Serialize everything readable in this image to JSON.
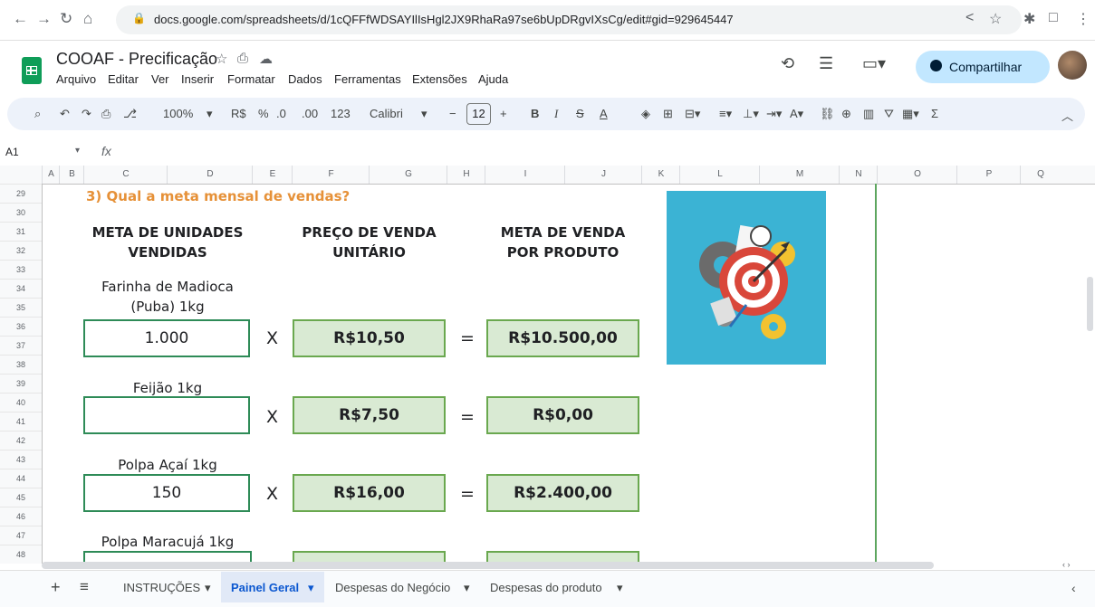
{
  "browser": {
    "url": "docs.google.com/spreadsheets/d/1cQFFfWDSAYIlIsHgl2JX9RhaRa97se6bUpDRgvIXsCg/edit#gid=929645447"
  },
  "doc": {
    "title": "COOAF - Precificação",
    "share_label": "Compartilhar",
    "menu": [
      "Arquivo",
      "Editar",
      "Ver",
      "Inserir",
      "Formatar",
      "Dados",
      "Ferramentas",
      "Extensões",
      "Ajuda"
    ]
  },
  "toolbar": {
    "zoom": "100%",
    "currency": "R$",
    "percent": "%",
    "dec_less": ".0",
    "dec_more": ".00",
    "number_format": "123",
    "font": "Calibri",
    "font_size": "12",
    "bold": "B",
    "italic": "I",
    "text_color": "A"
  },
  "formula": {
    "cell_ref": "A1",
    "fx": "fx"
  },
  "columns": [
    "A",
    "B",
    "C",
    "D",
    "E",
    "F",
    "G",
    "H",
    "I",
    "J",
    "K",
    "L",
    "M",
    "N",
    "O",
    "P",
    "Q"
  ],
  "rows": [
    "29",
    "30",
    "31",
    "32",
    "33",
    "34",
    "35",
    "36",
    "37",
    "38",
    "39",
    "40",
    "41",
    "42",
    "43",
    "44",
    "45",
    "46",
    "47",
    "48"
  ],
  "sheet": {
    "heading": "3) Qual a meta mensal de vendas?",
    "col1_l1": "META DE UNIDADES",
    "col1_l2": "VENDIDAS",
    "col2_l1": "PREÇO DE VENDA",
    "col2_l2": "UNITÁRIO",
    "col3_l1": "META DE VENDA",
    "col3_l2": "POR PRODUTO",
    "times": "X",
    "equals": "=",
    "products": [
      {
        "name_l1": "Farinha de Madioca",
        "name_l2": "(Puba) 1kg",
        "qty": "1.000",
        "price": "R$10,50",
        "meta": "R$10.500,00"
      },
      {
        "name_l1": "Feijão 1kg",
        "qty": "",
        "price": "R$7,50",
        "meta": "R$0,00"
      },
      {
        "name_l1": "Polpa Açaí 1kg",
        "qty": "150",
        "price": "R$16,00",
        "meta": "R$2.400,00"
      },
      {
        "name_l1": "Polpa Maracujá 1kg"
      }
    ]
  },
  "tabs": [
    "INSTRUÇÕES",
    "Painel Geral",
    "Despesas do Negócio",
    "Despesas do produto"
  ],
  "colors": {
    "accent_green": "#6aa84f",
    "heading_orange": "#e69138",
    "cell_fill": "#d9ead3"
  }
}
